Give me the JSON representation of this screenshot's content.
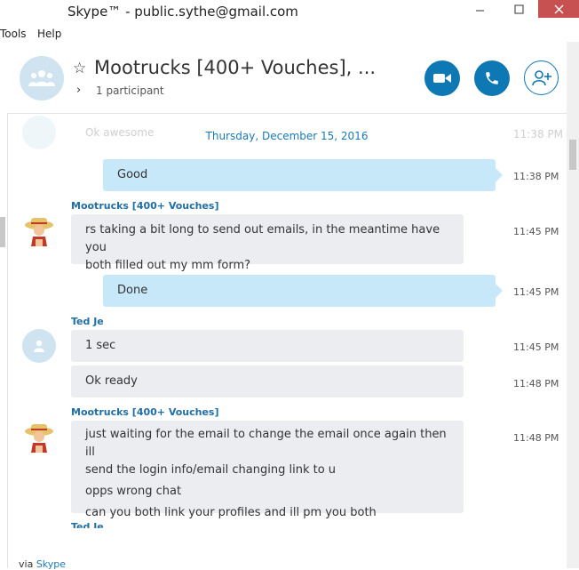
{
  "window": {
    "title": "Skype™ - public.sythe@gmail.com"
  },
  "menu": {
    "items": [
      "Tools",
      "Help"
    ]
  },
  "header": {
    "title": "Mootrucks [400+ Vouches], ...",
    "participants": "1 participant"
  },
  "chat": {
    "date": "Thursday, December 15, 2016",
    "ghost_text": "Ok awesome",
    "ghost_time": "11:38 PM",
    "messages": [
      {
        "text": "Good",
        "time": "11:38 PM"
      },
      {
        "sender": "Mootrucks [400+ Vouches]",
        "lines": [
          "rs taking a bit long to send out emails, in the meantime have you",
          "both filled out my mm form?"
        ],
        "time": "11:45 PM"
      },
      {
        "text": "Done",
        "time": "11:45 PM"
      },
      {
        "sender": "Ted Je",
        "text": "1 sec",
        "time": "11:45 PM"
      },
      {
        "text": "Ok ready",
        "time": "11:48 PM"
      },
      {
        "sender": "Mootrucks [400+ Vouches]",
        "lines": [
          "just waiting for the email to change the email once again then ill",
          "send the login info/email changing link to u",
          "opps wrong chat",
          "can you both link your profiles and ill pm you both"
        ],
        "time": "11:48 PM"
      },
      {
        "sender": "Ted Je"
      }
    ]
  },
  "footer": {
    "prefix": "via",
    "link": "Skype"
  },
  "colors": {
    "accent": "#0e78b5",
    "outgoing_bubble": "#c7e8f8",
    "incoming_bubble": "#ebedf1",
    "sender_name": "#1f6ea5"
  }
}
